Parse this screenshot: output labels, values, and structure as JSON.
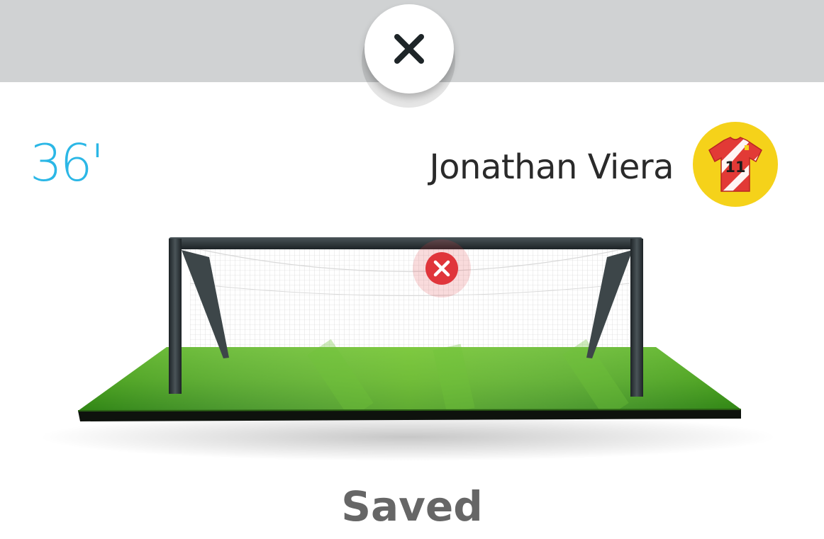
{
  "header": {
    "close_button_icon": "close-icon"
  },
  "event": {
    "minute": "36'",
    "player_name": "Jonathan Viera",
    "shirt_number": "11",
    "shirt_colors": {
      "primary": "#e23a36",
      "stripe": "#ffffff",
      "badge_background": "#f5d21a"
    },
    "shot_marker_icon": "x-circle-icon",
    "result": "Saved"
  },
  "colors": {
    "minute_accent": "#2bb7e6",
    "top_bar": "#d0d2d3",
    "marker_red": "#e0353b",
    "result_text": "#666666"
  }
}
